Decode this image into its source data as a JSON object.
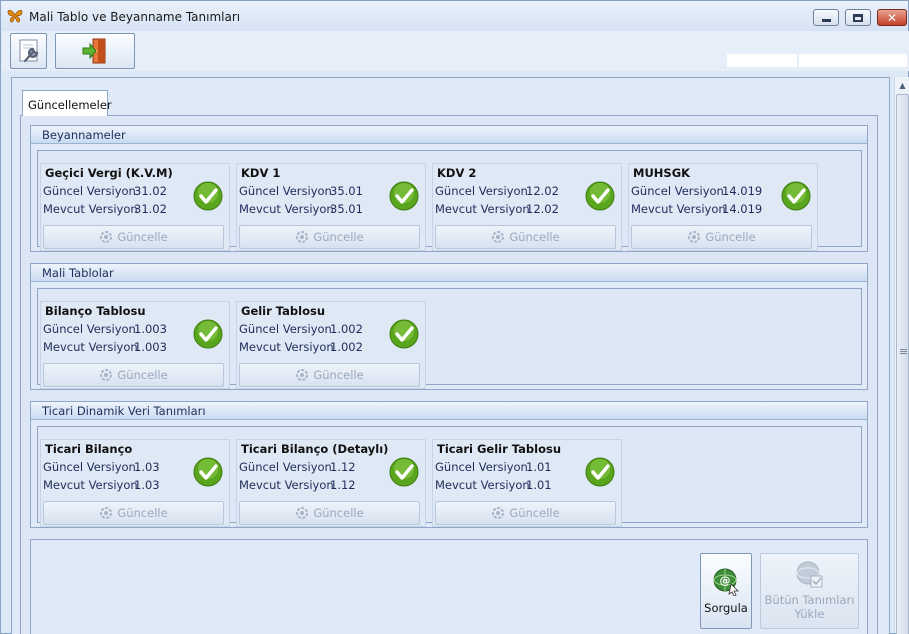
{
  "window": {
    "title": "Mali Tablo ve Beyanname Tanımları",
    "controls": {
      "minimize": "minimize",
      "maximize": "maximize",
      "close": "close"
    }
  },
  "toolbar": {
    "settings_icon": "settings-wrench-icon",
    "exit_icon": "exit-door-icon"
  },
  "tab": {
    "label": "Güncellemeler"
  },
  "labels": {
    "current": "Güncel Versiyon",
    "existing": "Mevcut Versiyon",
    "update": "Güncelle"
  },
  "groups": [
    {
      "title": "Beyannameler",
      "items": [
        {
          "name": "Geçici Vergi (K.V.M)",
          "current": "31.02",
          "existing": "31.02"
        },
        {
          "name": "KDV 1",
          "current": "35.01",
          "existing": "35.01"
        },
        {
          "name": "KDV 2",
          "current": "12.02",
          "existing": "12.02"
        },
        {
          "name": "MUHSGK",
          "current": "14.019",
          "existing": "14.019"
        }
      ]
    },
    {
      "title": "Mali Tablolar",
      "items": [
        {
          "name": "Bilanço Tablosu",
          "current": "1.003",
          "existing": "1.003"
        },
        {
          "name": "Gelir Tablosu",
          "current": "1.002",
          "existing": "1.002"
        }
      ]
    },
    {
      "title": "Ticari Dinamik Veri Tanımları",
      "items": [
        {
          "name": "Ticari Bilanço",
          "current": "1.03",
          "existing": "1.03"
        },
        {
          "name": "Ticari Bilanço (Detaylı)",
          "current": "1.12",
          "existing": "1.12"
        },
        {
          "name": "Ticari Gelir Tablosu",
          "current": "1.01",
          "existing": "1.01"
        }
      ]
    }
  ],
  "actions": {
    "query_label": "Sorgula",
    "load_all_line1": "Bütün Tanımları",
    "load_all_line2": "Yükle"
  },
  "colors": {
    "check_green": "#5aa51e",
    "accent_blue": "#1e2d5a"
  }
}
